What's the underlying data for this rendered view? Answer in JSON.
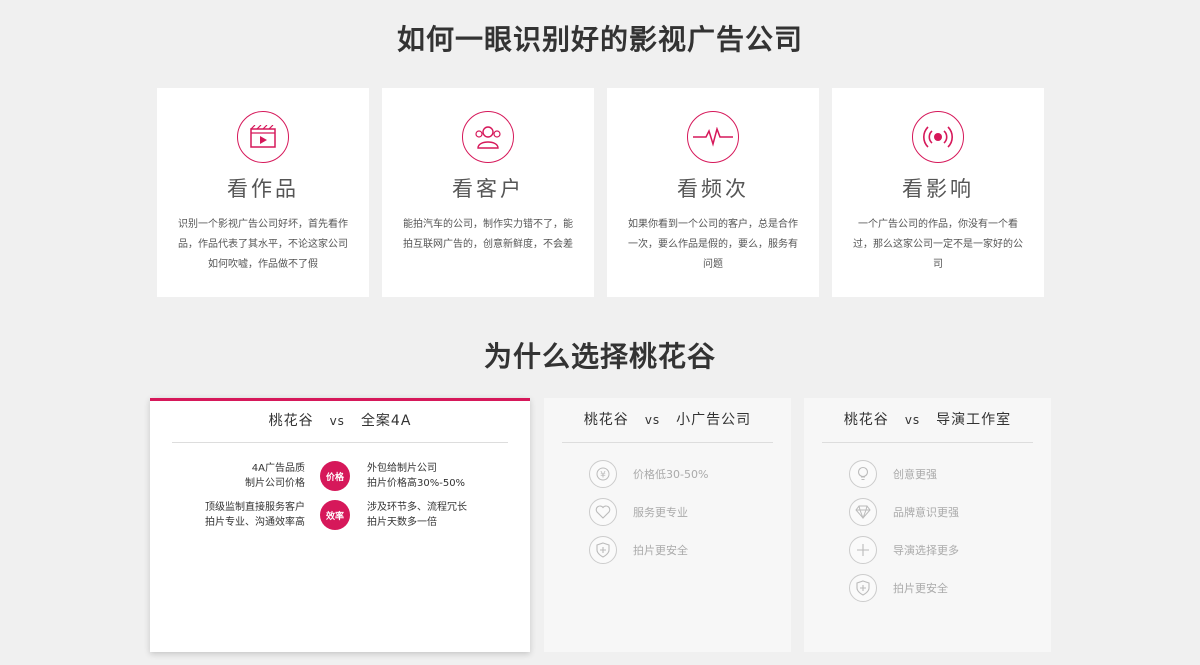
{
  "section1": {
    "title": "如何一眼识别好的影视广告公司",
    "cards": [
      {
        "icon": "film-play-icon",
        "title": "看作品",
        "desc": "识别一个影视广告公司好坏，首先看作品，作品代表了其水平，不论这家公司如何吹嘘，作品做不了假"
      },
      {
        "icon": "customers-icon",
        "title": "看客户",
        "desc": "能拍汽车的公司，制作实力错不了，能拍互联网广告的，创意新鲜度，不会差"
      },
      {
        "icon": "heartbeat-pulse-icon",
        "title": "看频次",
        "desc": "如果你看到一个公司的客户，总是合作一次，要么作品是假的，要么，服务有问题"
      },
      {
        "icon": "broadcast-signal-icon",
        "title": "看影响",
        "desc": "一个广告公司的作品，你没有一个看过，那么这家公司一定不是一家好的公司"
      }
    ]
  },
  "section2": {
    "title": "为什么选择桃花谷",
    "compare_main": {
      "left_name": "桃花谷",
      "vs": "vs",
      "right_name": "全案4A",
      "rows": [
        {
          "left1": "4A广告品质",
          "left2": "制片公司价格",
          "badge": "价格",
          "right1": "外包给制片公司",
          "right2": "拍片价格高30%-50%"
        },
        {
          "left1": "顶级监制直接服务客户",
          "left2": "拍片专业、沟通效率高",
          "badge": "效率",
          "right1": "涉及环节多、流程冗长",
          "right2": "拍片天数多一倍"
        }
      ]
    },
    "compare_small": {
      "left_name": "桃花谷",
      "vs": "vs",
      "right_name": "小广告公司",
      "features": [
        {
          "icon": "price-down-icon",
          "label": "价格低30-50%"
        },
        {
          "icon": "heart-icon",
          "label": "服务更专业"
        },
        {
          "icon": "shield-plus-icon",
          "label": "拍片更安全"
        }
      ]
    },
    "compare_studio": {
      "left_name": "桃花谷",
      "vs": "vs",
      "right_name": "导演工作室",
      "features": [
        {
          "icon": "lightbulb-icon",
          "label": "创意更强"
        },
        {
          "icon": "diamond-icon",
          "label": "品牌意识更强"
        },
        {
          "icon": "plus-icon",
          "label": "导演选择更多"
        },
        {
          "icon": "shield-plus-icon",
          "label": "拍片更安全"
        }
      ]
    }
  },
  "colors": {
    "accent": "#d6185a",
    "background": "#f0f0f0"
  }
}
